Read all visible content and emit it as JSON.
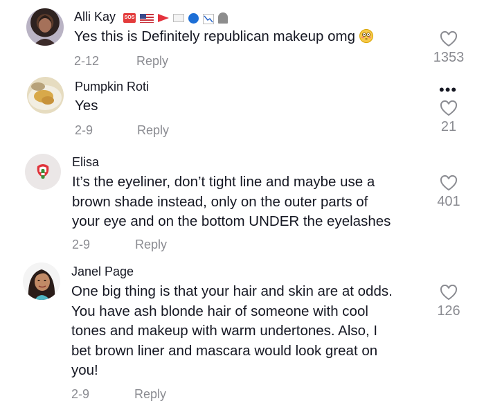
{
  "comments": [
    {
      "author": "Alli Kay",
      "badges": [
        "sos-icon",
        "us-flag-icon",
        "red-pennant-icon",
        "white-flag-icon",
        "blue-circle-icon",
        "chart-down-icon",
        "headstone-icon"
      ],
      "badge_sos_text": "SOS",
      "text": "Yes this is Definitely republican makeup omg",
      "emoji": "flushed-face-icon",
      "date": "2-12",
      "reply_label": "Reply",
      "likes": "1353"
    },
    {
      "author": "Pumpkin Roti",
      "text": "Yes",
      "date": "2-9",
      "reply_label": "Reply",
      "likes": "21",
      "more_label": "•••"
    },
    {
      "author": "Elisa",
      "text_lines": [
        "It’s the eyeliner, don’t tight line and maybe use a",
        "brown shade instead, only on the outer parts of",
        "your eye and on the bottom UNDER the eyelashes"
      ],
      "date": "2-9",
      "reply_label": "Reply",
      "likes": "401"
    },
    {
      "author": "Janel Page",
      "text_lines": [
        "One big thing is that your hair and skin are at odds.",
        "You have ash blonde hair of someone with cool",
        "tones and makeup with warm undertones. Also, I",
        "bet brown liner and mascara would look great on",
        "you!"
      ],
      "date": "2-9",
      "reply_label": "Reply",
      "likes": "126"
    }
  ],
  "colors": {
    "text": "#161823",
    "muted": "#8a8b91",
    "background": "#ffffff"
  }
}
